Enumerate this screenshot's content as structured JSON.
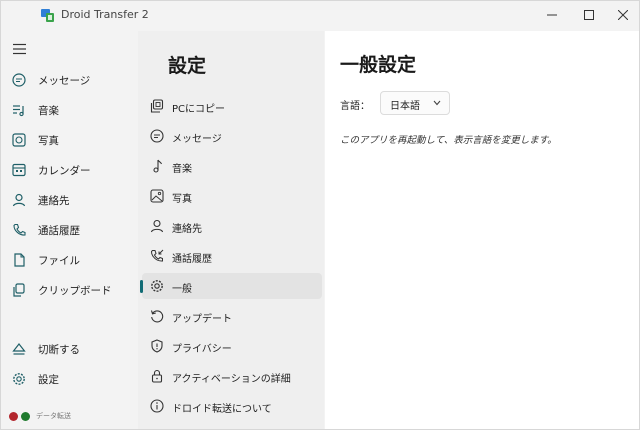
{
  "window": {
    "title": "Droid Transfer 2",
    "controls": {
      "minimize": "—",
      "maximize": "☐",
      "close": "✕"
    }
  },
  "colors": {
    "accent": "#116b74",
    "status_red": "#b3262d",
    "status_green": "#1f7a2e"
  },
  "leftnav": {
    "items": [
      {
        "label": "メッセージ",
        "icon": "message-icon"
      },
      {
        "label": "音楽",
        "icon": "music-icon"
      },
      {
        "label": "写真",
        "icon": "photo-icon"
      },
      {
        "label": "カレンダー",
        "icon": "calendar-icon"
      },
      {
        "label": "連絡先",
        "icon": "contact-icon"
      },
      {
        "label": "通話履歴",
        "icon": "phone-icon"
      },
      {
        "label": "ファイル",
        "icon": "file-icon"
      },
      {
        "label": "クリップボード",
        "icon": "clipboard-icon"
      }
    ],
    "bottom": [
      {
        "label": "切断する",
        "icon": "eject-icon"
      },
      {
        "label": "設定",
        "icon": "gear-icon"
      }
    ],
    "status_label": "データ転送"
  },
  "settings_panel": {
    "title": "設定",
    "items": [
      {
        "label": "PCにコピー",
        "icon": "copy-to-pc-icon"
      },
      {
        "label": "メッセージ",
        "icon": "message-icon"
      },
      {
        "label": "音楽",
        "icon": "music-note-icon"
      },
      {
        "label": "写真",
        "icon": "photo-icon"
      },
      {
        "label": "連絡先",
        "icon": "contact-icon"
      },
      {
        "label": "通話履歴",
        "icon": "call-history-icon"
      },
      {
        "label": "一般",
        "icon": "gear-icon",
        "selected": true
      },
      {
        "label": "アップデート",
        "icon": "update-icon"
      },
      {
        "label": "プライバシー",
        "icon": "shield-icon"
      },
      {
        "label": "アクティベーションの詳細",
        "icon": "lock-icon"
      },
      {
        "label": "ドロイド転送について",
        "icon": "info-icon"
      }
    ]
  },
  "content": {
    "title": "一般設定",
    "language_label": "言語：",
    "language_value": "日本語",
    "note": "このアプリを再起動して、表示言語を変更します。"
  }
}
